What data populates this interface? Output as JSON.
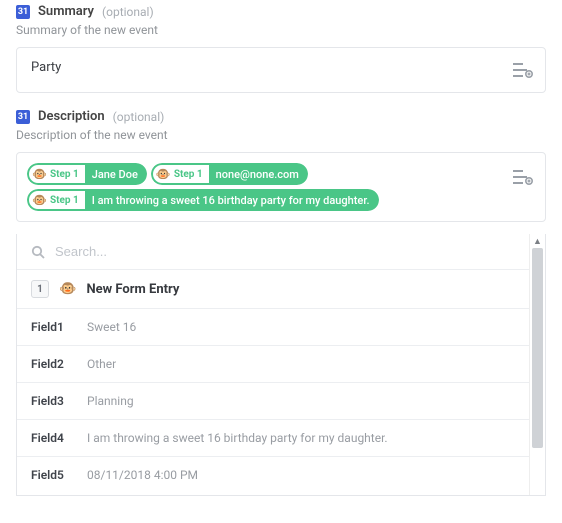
{
  "summary": {
    "title": "Summary",
    "optional": "(optional)",
    "hint": "Summary of the new event",
    "value": "Party"
  },
  "description": {
    "title": "Description",
    "optional": "(optional)",
    "hint": "Description of the new event",
    "tag_step": "Step 1",
    "tags": [
      "Jane Doe",
      "none@none.com",
      "I am throwing a sweet 16 birthday party for my daughter."
    ]
  },
  "picker": {
    "search_placeholder": "Search...",
    "entry_num": "1",
    "entry_title": "New Form Entry",
    "fields": [
      {
        "name": "Field1",
        "value": "Sweet 16"
      },
      {
        "name": "Field2",
        "value": "Other"
      },
      {
        "name": "Field3",
        "value": "Planning"
      },
      {
        "name": "Field4",
        "value": "I am throwing a sweet 16 birthday party for my daughter."
      },
      {
        "name": "Field5",
        "value": "08/11/2018 4:00 PM"
      }
    ]
  }
}
